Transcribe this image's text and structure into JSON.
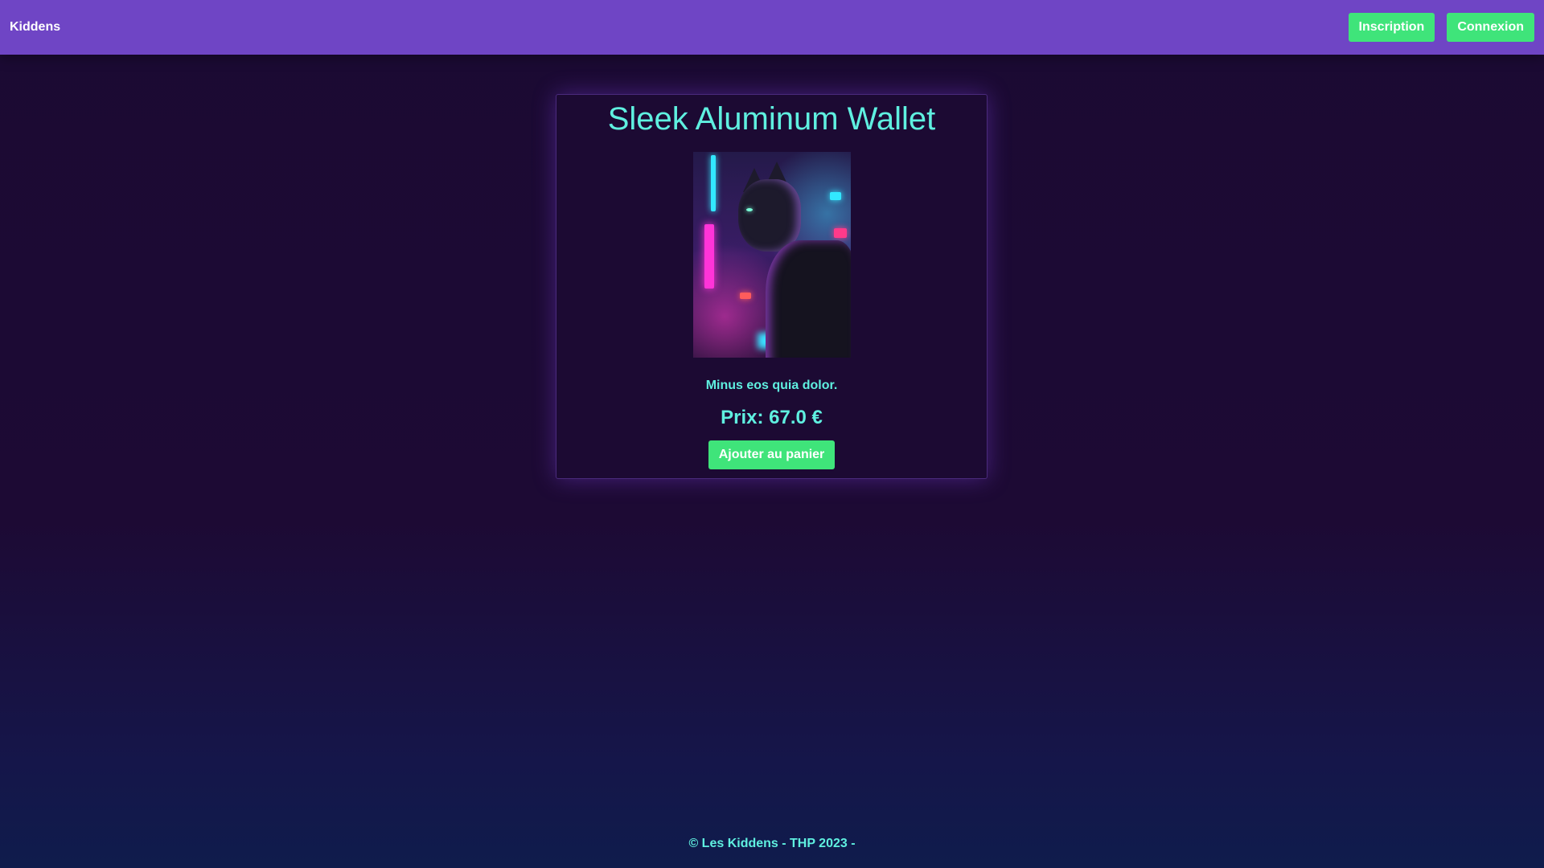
{
  "navbar": {
    "brand": "Kiddens",
    "signup_label": "Inscription",
    "login_label": "Connexion"
  },
  "product": {
    "title": "Sleek Aluminum Wallet",
    "image_alt": "Cyberpunk neon cat illustration",
    "description": "Minus eos quia dolor.",
    "price": "Prix: 67.0 €",
    "add_to_cart_label": "Ajouter au panier"
  },
  "footer": {
    "text": "© Les Kiddens - THP 2023 -"
  },
  "colors": {
    "navbar": "#6f45c5",
    "accent_button": "#3fe47a",
    "text_teal": "#5ff0e0",
    "background": "#1b0a33"
  }
}
